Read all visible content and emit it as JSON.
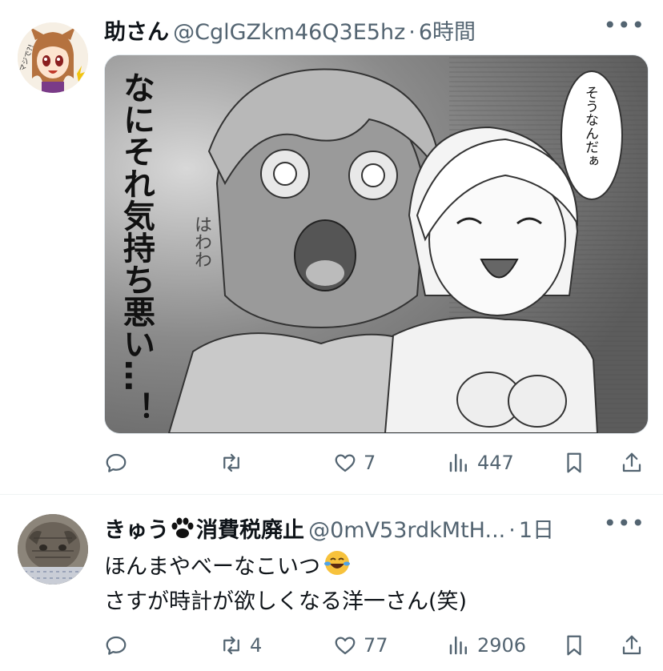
{
  "tweets": [
    {
      "name": "助さん",
      "handle": "@CglGZkm46Q3E5hz",
      "separator": "·",
      "time": "6時間",
      "more_icon": "more-icon",
      "media": {
        "caption_main": "なにそれ気持ち悪い…！",
        "bubble": "そうなんだぁ",
        "sfx": "はわわ"
      },
      "actions": {
        "reply": "",
        "retweet": "",
        "like": "7",
        "views": "447"
      }
    },
    {
      "name": "きゅう🐾消費税廃止",
      "name_prefix": "きゅう",
      "name_suffix": "消費税廃止",
      "handle": "@0mV53rdkMtH...",
      "separator": "·",
      "time": "1日",
      "text_line1": "ほんまやべーなこいつ",
      "text_line2": "さすが時計が欲しくなる洋一さん(笑)",
      "actions": {
        "reply": "",
        "retweet": "4",
        "like": "77",
        "views": "2906"
      }
    }
  ]
}
